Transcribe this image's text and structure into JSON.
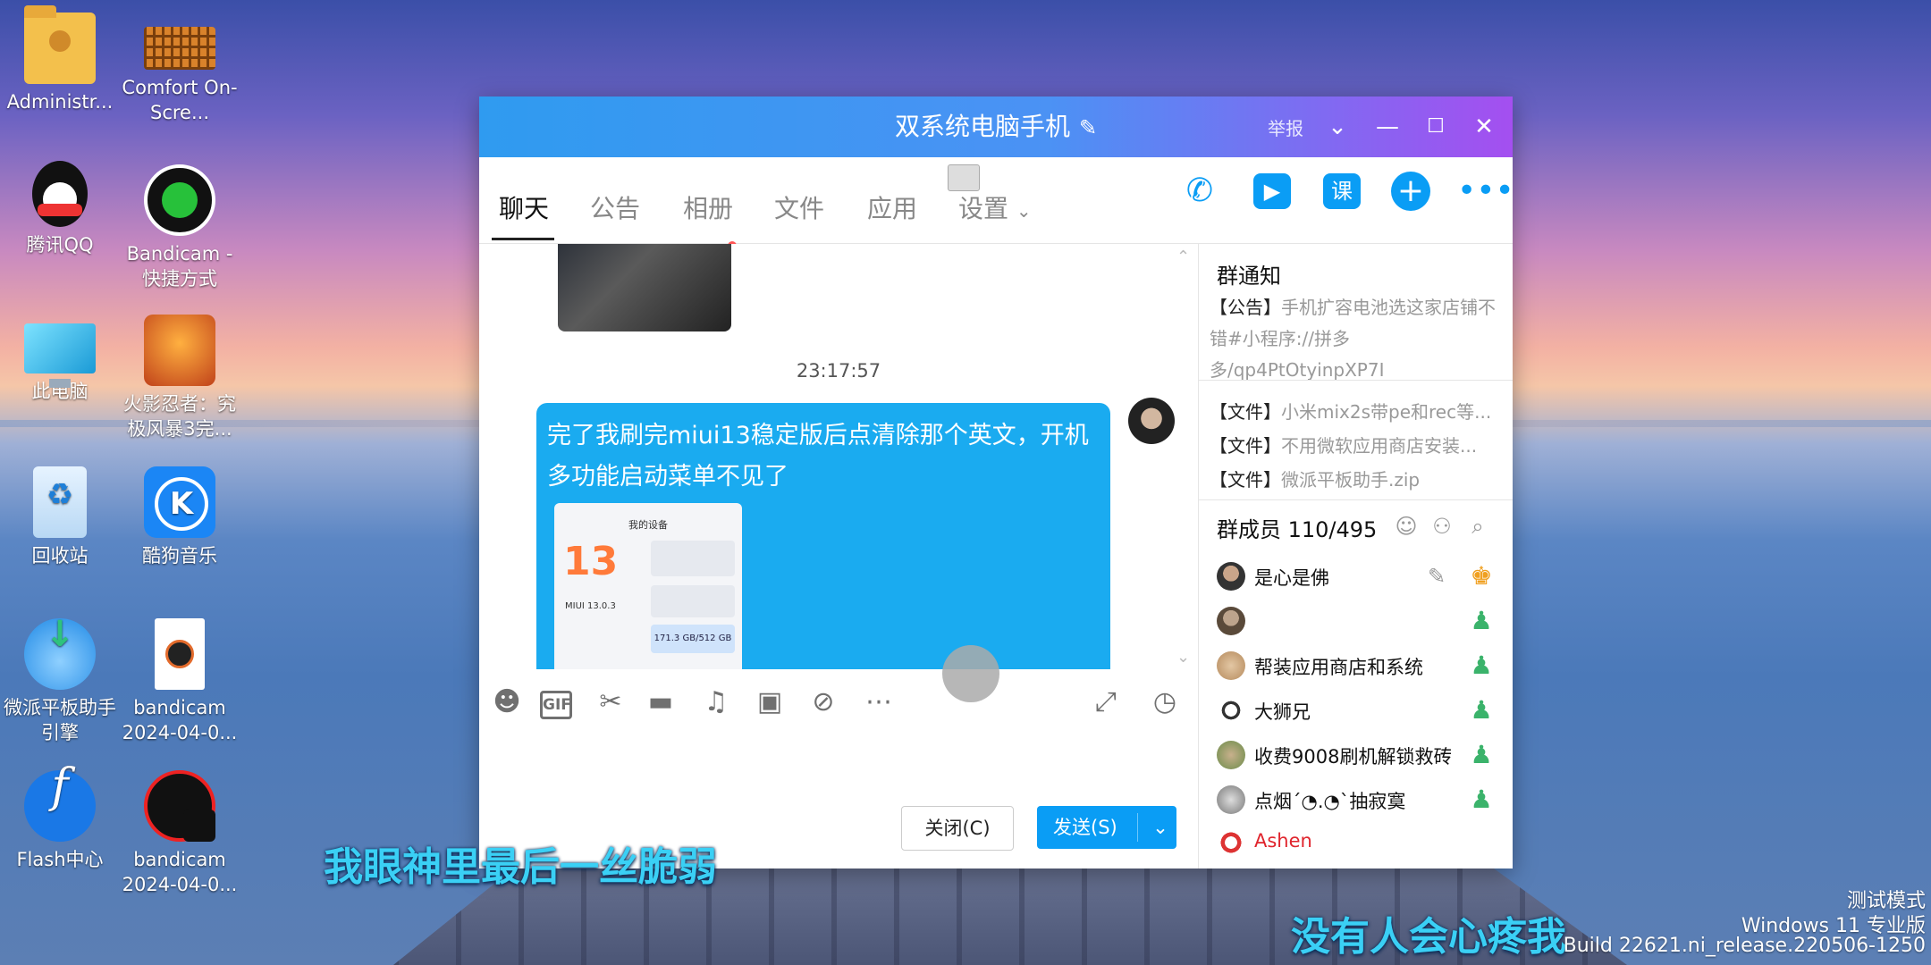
{
  "desktop": {
    "icons": [
      {
        "label": "Administr..."
      },
      {
        "label": "Comfort On-Scre..."
      },
      {
        "label": "腾讯QQ"
      },
      {
        "label": "Bandicam - 快捷方式"
      },
      {
        "label": "此电脑"
      },
      {
        "label": "火影忍者：究极风暴3完..."
      },
      {
        "label": "回收站"
      },
      {
        "label": "酷狗音乐"
      },
      {
        "label": "微派平板助手引擎"
      },
      {
        "label": "bandicam 2024-04-0..."
      },
      {
        "label": "Flash中心"
      },
      {
        "label": "bandicam 2024-04-0..."
      }
    ]
  },
  "window": {
    "title": "双系统电脑手机",
    "report": "举报",
    "tabs": [
      "聊天",
      "公告",
      "相册",
      "文件",
      "应用",
      "设置"
    ]
  },
  "chat": {
    "timestamp": "23:17:57",
    "message": "完了我刷完miui13稳定版后点清除那个英文，开机多功能启动菜单不见了",
    "screenshot": {
      "header": "我的设备",
      "logo": "13",
      "version": "MIUI 13.0.3",
      "storage": "171.3 GB/512 GB"
    }
  },
  "input": {
    "close_label": "关闭(C)",
    "send_label": "发送(S)"
  },
  "sidebar": {
    "notice_title": "群通知",
    "announcement_tag": "【公告】",
    "announcement_text": "手机扩容电池选这家店铺不错#小程序://拼多多/qp4PtOtyinpXP7I",
    "files": [
      {
        "tag": "【文件】",
        "name": "小米mix2s带pe和rec等..."
      },
      {
        "tag": "【文件】",
        "name": "不用微软应用商店安装..."
      },
      {
        "tag": "【文件】",
        "name": "微派平板助手.zip"
      }
    ],
    "members_title": "群成员 110/495",
    "members": [
      {
        "name": "是心是佛"
      },
      {
        "name": ""
      },
      {
        "name": "帮装应用商店和系统"
      },
      {
        "name": "大狮兄"
      },
      {
        "name": "收费9008刷机解锁救砖"
      },
      {
        "name": "点烟´◔.◔`抽寂寞"
      },
      {
        "name": "Ashen",
        "color": "#e0242c"
      }
    ]
  },
  "captions": {
    "line1": "我眼神里最后一丝脆弱",
    "line2": "没有人会心疼我"
  },
  "watermark": {
    "line1": "测试模式",
    "line2": "Windows 11 专业版",
    "line3": "Build 22621.ni_release.220506-1250"
  },
  "colors": {
    "accent": "#0a9df5",
    "bubble": "#1aabf0",
    "title_gradient_start": "#2f9bf0",
    "title_gradient_end": "#a44ff0"
  }
}
